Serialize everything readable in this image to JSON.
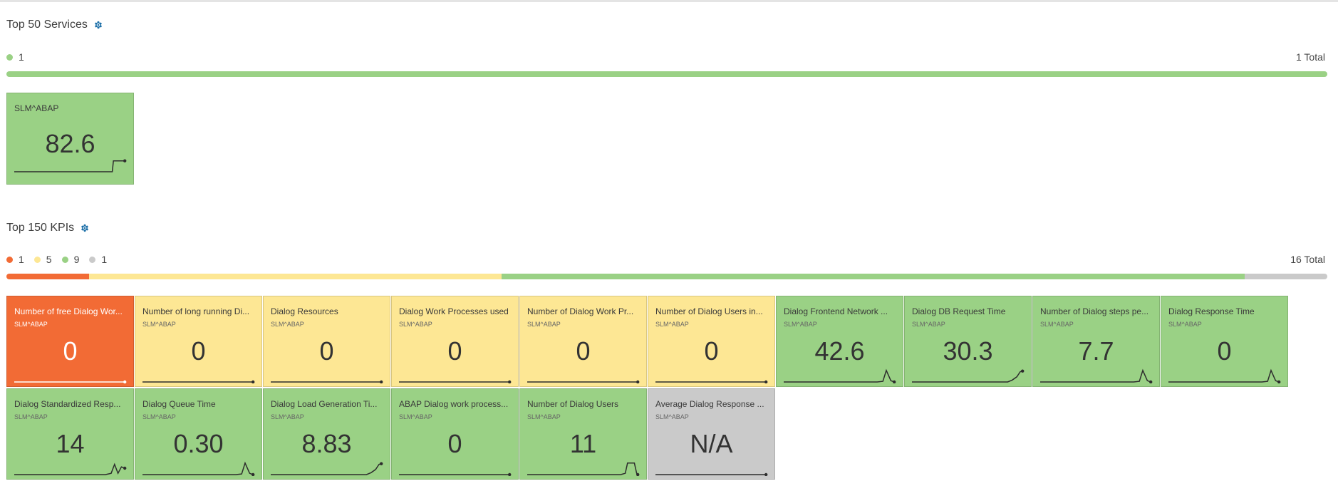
{
  "colors": {
    "critical": "#f26b35",
    "warning": "#fde794",
    "normal": "#9ad185",
    "unknown": "#cacaca",
    "gear": "#1c6fa8"
  },
  "services": {
    "title": "Top 50 Services",
    "icon": "gear-icon",
    "legend": [
      {
        "status": "normal",
        "count": "1"
      }
    ],
    "total": "1 Total",
    "distribution": [
      {
        "status": "normal",
        "fraction": 1.0
      }
    ],
    "tiles": [
      {
        "title": "SLM^ABAP",
        "value": "82.6",
        "status": "normal",
        "spark": "step-up"
      }
    ]
  },
  "kpis": {
    "title": "Top 150 KPIs",
    "icon": "gear-icon",
    "legend": [
      {
        "status": "critical",
        "count": "1"
      },
      {
        "status": "warning",
        "count": "5"
      },
      {
        "status": "normal",
        "count": "9"
      },
      {
        "status": "unknown",
        "count": "1"
      }
    ],
    "total": "16 Total",
    "distribution": [
      {
        "status": "critical",
        "fraction": 0.0625
      },
      {
        "status": "warning",
        "fraction": 0.3125
      },
      {
        "status": "normal",
        "fraction": 0.5625
      },
      {
        "status": "unknown",
        "fraction": 0.0625
      }
    ],
    "tiles": [
      {
        "title": "Number of free Dialog Wor...",
        "subtitle": "SLM^ABAP",
        "value": "0",
        "status": "critical",
        "spark": "flat"
      },
      {
        "title": "Number of long running Di...",
        "subtitle": "SLM^ABAP",
        "value": "0",
        "status": "warning",
        "spark": "flat"
      },
      {
        "title": "Dialog Resources",
        "subtitle": "SLM^ABAP",
        "value": "0",
        "status": "warning",
        "spark": "flat"
      },
      {
        "title": "Dialog Work Processes used",
        "subtitle": "SLM^ABAP",
        "value": "0",
        "status": "warning",
        "spark": "flat"
      },
      {
        "title": "Number of Dialog Work Pr...",
        "subtitle": "SLM^ABAP",
        "value": "0",
        "status": "warning",
        "spark": "flat"
      },
      {
        "title": "Number of Dialog Users in...",
        "subtitle": "SLM^ABAP",
        "value": "0",
        "status": "warning",
        "spark": "flat"
      },
      {
        "title": "Dialog Frontend Network ...",
        "subtitle": "SLM^ABAP",
        "value": "42.6",
        "status": "normal",
        "spark": "spike"
      },
      {
        "title": "Dialog DB Request Time",
        "subtitle": "SLM^ABAP",
        "value": "30.3",
        "status": "normal",
        "spark": "rise"
      },
      {
        "title": "Number of Dialog steps pe...",
        "subtitle": "SLM^ABAP",
        "value": "7.7",
        "status": "normal",
        "spark": "spike"
      },
      {
        "title": "Dialog Response Time",
        "subtitle": "SLM^ABAP",
        "value": "0",
        "status": "normal",
        "spark": "spike"
      },
      {
        "title": "Dialog Standardized Resp...",
        "subtitle": "SLM^ABAP",
        "value": "14",
        "status": "normal",
        "spark": "double-spike"
      },
      {
        "title": "Dialog Queue Time",
        "subtitle": "SLM^ABAP",
        "value": "0.30",
        "status": "normal",
        "spark": "spike"
      },
      {
        "title": "Dialog Load Generation Ti...",
        "subtitle": "SLM^ABAP",
        "value": "8.83",
        "status": "normal",
        "spark": "rise"
      },
      {
        "title": "ABAP Dialog work process...",
        "subtitle": "SLM^ABAP",
        "value": "0",
        "status": "normal",
        "spark": "flat"
      },
      {
        "title": "Number of Dialog Users",
        "subtitle": "SLM^ABAP",
        "value": "11",
        "status": "normal",
        "spark": "plateau"
      },
      {
        "title": "Average Dialog Response ...",
        "subtitle": "SLM^ABAP",
        "value": "N/A",
        "status": "unknown",
        "spark": "flat"
      }
    ]
  }
}
